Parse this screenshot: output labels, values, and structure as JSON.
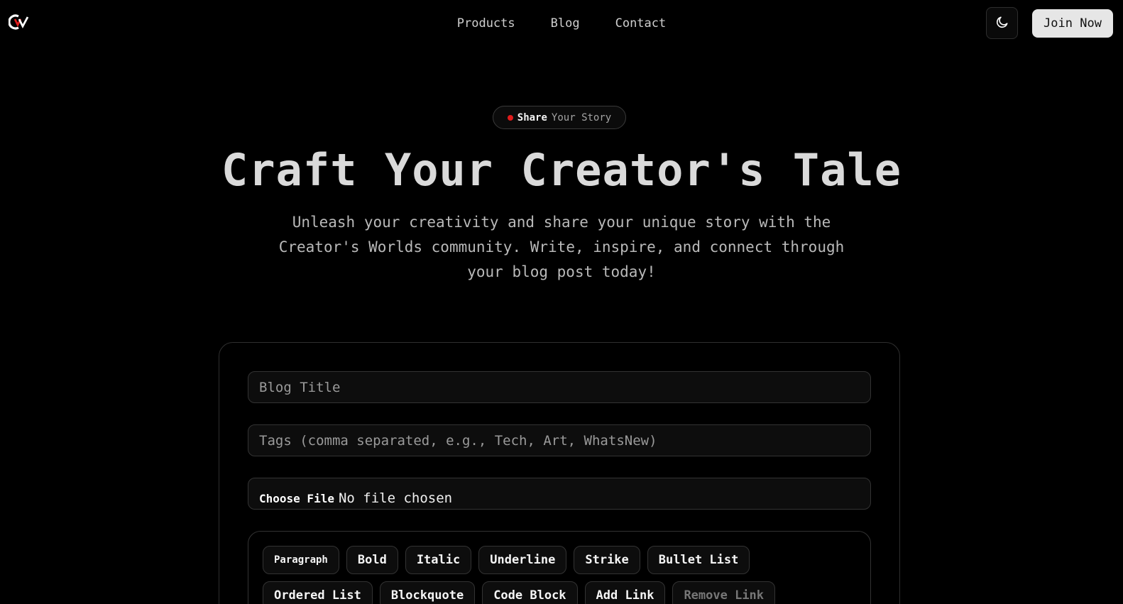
{
  "header": {
    "nav": [
      "Products",
      "Blog",
      "Contact"
    ],
    "join_label": "Join Now"
  },
  "icons": {
    "logo": "cv-logo",
    "theme": "moon-icon"
  },
  "hero": {
    "badge_strong": "Share",
    "badge_rest": "Your Story",
    "title": "Craft Your Creator's Tale",
    "subtitle": "Unleash your creativity and share your unique story with the Creator's Worlds community. Write, inspire, and connect through your blog post today!"
  },
  "form": {
    "title_placeholder": "Blog Title",
    "tags_placeholder": "Tags (comma separated, e.g., Tech, Art, WhatsNew)",
    "file_button": "Choose File",
    "file_status": "No file chosen",
    "toolbar": [
      "Paragraph",
      "Bold",
      "Italic",
      "Underline",
      "Strike",
      "Bullet List",
      "Ordered List",
      "Blockquote",
      "Code Block",
      "Add Link",
      "Remove Link"
    ]
  },
  "colors": {
    "background": "#000000",
    "accent_dot": "#e01b1b"
  }
}
